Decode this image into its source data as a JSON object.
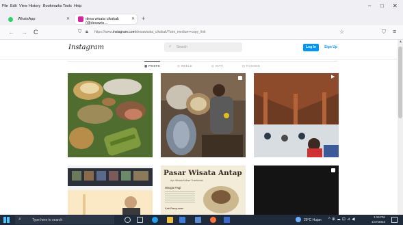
{
  "menu": [
    "File",
    "Edit",
    "View",
    "History",
    "Bookmarks",
    "Tools",
    "Help"
  ],
  "window_controls": {
    "minimize": "–",
    "restore": "□",
    "close": "✕"
  },
  "tabs": [
    {
      "label": "WhatsApp",
      "active": false
    },
    {
      "label": "desa wisata cikakak (@desawis…",
      "active": true
    }
  ],
  "new_tab_label": "+",
  "nav": {
    "back": "←",
    "forward": "→",
    "reload": "C"
  },
  "url": {
    "host": "instagram.com",
    "prefix": "https://www.",
    "path": "/desawisata_cikakak/?utm_medium=copy_link"
  },
  "instagram": {
    "logo": "Instagram",
    "search_placeholder": "Search",
    "login_label": "Log In",
    "signup_label": "Sign Up",
    "tabs": [
      "POSTS",
      "REELS",
      "IGTV",
      "TAGGED"
    ]
  },
  "posts": [
    {
      "caption": ""
    },
    {
      "caption": ""
    },
    {
      "caption": ""
    },
    {
      "caption": ""
    },
    {
      "title": "Pasar Wisata Antap",
      "subtitle": "Ayo Wisata Kuliner Tradisional",
      "lines": [
        "Warga Pagi",
        "Kab Banyumas"
      ]
    },
    {
      "caption": ""
    }
  ],
  "taskbar": {
    "search_placeholder": "Type here to search",
    "weather": "29°C Hujan",
    "time": "1:16 PM",
    "date": "1/17/2022"
  },
  "colors": {
    "ig_blue": "#0095f6",
    "taskbar": "#1f2a3a"
  }
}
